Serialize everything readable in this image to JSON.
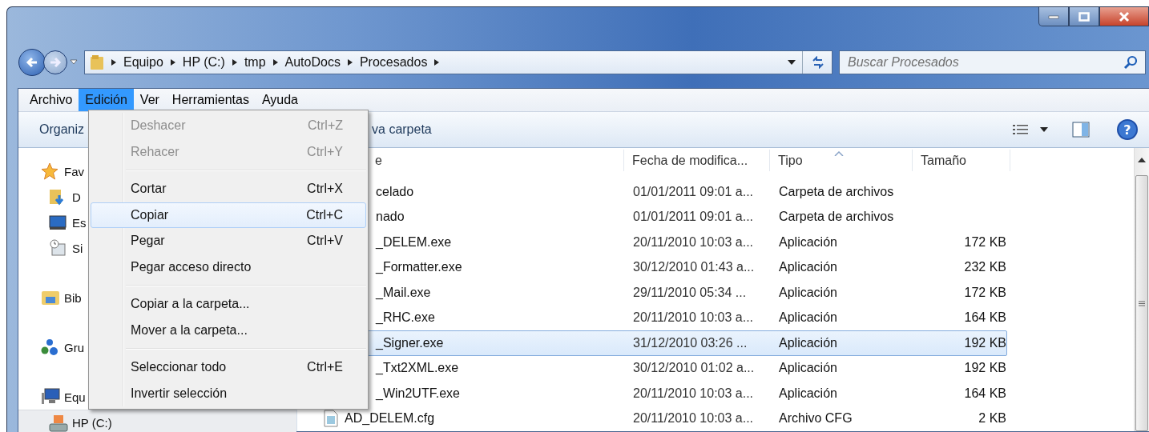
{
  "address_bar": {
    "breadcrumbs": [
      "Equipo",
      "HP (C:)",
      "tmp",
      "AutoDocs",
      "Procesados"
    ]
  },
  "search": {
    "placeholder": "Buscar Procesados"
  },
  "menu_bar": [
    {
      "label": "Archivo",
      "selected": false
    },
    {
      "label": "Edición",
      "selected": true
    },
    {
      "label": "Ver",
      "selected": false
    },
    {
      "label": "Herramientas",
      "selected": false
    },
    {
      "label": "Ayuda",
      "selected": false
    }
  ],
  "edit_menu": [
    {
      "kind": "item",
      "label": "Deshacer",
      "shortcut": "Ctrl+Z",
      "disabled": true,
      "selected": false
    },
    {
      "kind": "item",
      "label": "Rehacer",
      "shortcut": "Ctrl+Y",
      "disabled": true,
      "selected": false
    },
    {
      "kind": "separator"
    },
    {
      "kind": "item",
      "label": "Cortar",
      "shortcut": "Ctrl+X",
      "disabled": false,
      "selected": false
    },
    {
      "kind": "item",
      "label": "Copiar",
      "shortcut": "Ctrl+C",
      "disabled": false,
      "selected": true
    },
    {
      "kind": "item",
      "label": "Pegar",
      "shortcut": "Ctrl+V",
      "disabled": false,
      "selected": false
    },
    {
      "kind": "item",
      "label": "Pegar acceso directo",
      "disabled": false,
      "selected": false
    },
    {
      "kind": "separator"
    },
    {
      "kind": "item",
      "label": "Copiar a la carpeta...",
      "disabled": false,
      "selected": false
    },
    {
      "kind": "item",
      "label": "Mover a la carpeta...",
      "disabled": false,
      "selected": false
    },
    {
      "kind": "separator"
    },
    {
      "kind": "item",
      "label": "Seleccionar todo",
      "shortcut": "Ctrl+E",
      "disabled": false,
      "selected": false
    },
    {
      "kind": "item",
      "label": "Invertir selección",
      "disabled": false,
      "selected": false
    }
  ],
  "toolbar": {
    "buttons": [
      "Organiz",
      "va carpeta"
    ],
    "help": "?"
  },
  "navigation": [
    {
      "label": "Fav",
      "kind": "favorites",
      "selected": false,
      "children": [
        {
          "label": "D",
          "kind": "downloads",
          "selected": false
        },
        {
          "label": "Es",
          "kind": "desktop",
          "selected": false
        },
        {
          "label": "Si",
          "kind": "recent",
          "selected": false
        }
      ]
    },
    {
      "label": "Bib",
      "kind": "libraries",
      "selected": false
    },
    {
      "label": "Gru",
      "kind": "homegroup",
      "selected": false
    },
    {
      "label": "Equ",
      "kind": "computer",
      "selected": false,
      "children": [
        {
          "label": "HP (C:)",
          "kind": "drive",
          "selected": true
        }
      ]
    }
  ],
  "file_list": {
    "columns": [
      {
        "label": "e",
        "sorted": false
      },
      {
        "label": "Fecha de modifica...",
        "sorted": false
      },
      {
        "label": "Tipo",
        "sorted": true
      },
      {
        "label": "Tamaño",
        "sorted": false
      }
    ],
    "rows": [
      {
        "name": "celado",
        "date": "01/01/2011 09:01 a...",
        "type": "Carpeta de archivos",
        "icon": false,
        "selected": false
      },
      {
        "name": "nado",
        "date": "01/01/2011 09:01 a...",
        "type": "Carpeta de archivos",
        "icon": false,
        "selected": false
      },
      {
        "name": "_DELEM.exe",
        "date": "20/11/2010 10:03 a...",
        "type": "Aplicación",
        "size": "172 KB",
        "icon": false,
        "selected": false
      },
      {
        "name": "_Formatter.exe",
        "date": "30/12/2010 01:43 a...",
        "type": "Aplicación",
        "size": "232 KB",
        "icon": false,
        "selected": false
      },
      {
        "name": "_Mail.exe",
        "date": "29/11/2010 05:34 ...",
        "type": "Aplicación",
        "size": "172 KB",
        "icon": false,
        "selected": false
      },
      {
        "name": "_RHC.exe",
        "date": "20/11/2010 10:03 a...",
        "type": "Aplicación",
        "size": "164 KB",
        "icon": false,
        "selected": false
      },
      {
        "name": "_Signer.exe",
        "date": "31/12/2010 03:26 ...",
        "type": "Aplicación",
        "size": "192 KB",
        "icon": false,
        "selected": true
      },
      {
        "name": "_Txt2XML.exe",
        "date": "30/12/2010 01:02 a...",
        "type": "Aplicación",
        "size": "192 KB",
        "icon": false,
        "selected": false
      },
      {
        "name": "_Win2UTF.exe",
        "date": "20/11/2010 10:03 a...",
        "type": "Aplicación",
        "size": "164 KB",
        "icon": false,
        "selected": false
      },
      {
        "name": "AD_DELEM.cfg",
        "date": "20/11/2010 10:03 a...",
        "type": "Archivo CFG",
        "size": "2 KB",
        "icon": true,
        "selected": false
      }
    ]
  }
}
